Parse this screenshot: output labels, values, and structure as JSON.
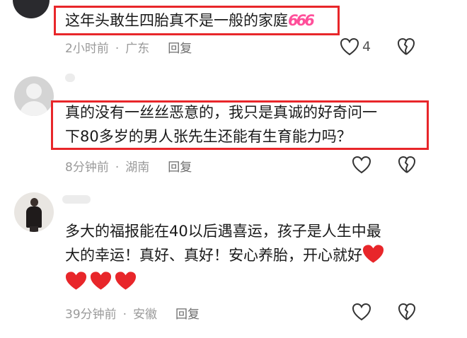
{
  "comments": [
    {
      "text_lines": [
        "这年头敢生四胎真不是一般的家庭"
      ],
      "emoji_suffix": "666",
      "time": "2小时前",
      "location": "广东",
      "reply_label": "回复",
      "like_count": "4"
    },
    {
      "text_lines": [
        "真的没有一丝丝恶意的，我只是真诚的好奇问一",
        "下80多岁的男人张先生还能有生育能力吗？"
      ],
      "time": "8分钟前",
      "location": "湖南",
      "reply_label": "回复",
      "like_count": ""
    },
    {
      "text_lines": [
        "多大的福报能在40以后遇喜运，孩子是人生中最",
        "大的幸运！真好、真好！安心养胎，开心就好"
      ],
      "time": "39分钟前",
      "location": "安徽",
      "reply_label": "回复",
      "like_count": "",
      "emoji": "red-heart"
    }
  ],
  "colors": {
    "highlight": "#e8262a",
    "heart": "#e8262a",
    "meta": "#9a9a9a"
  }
}
